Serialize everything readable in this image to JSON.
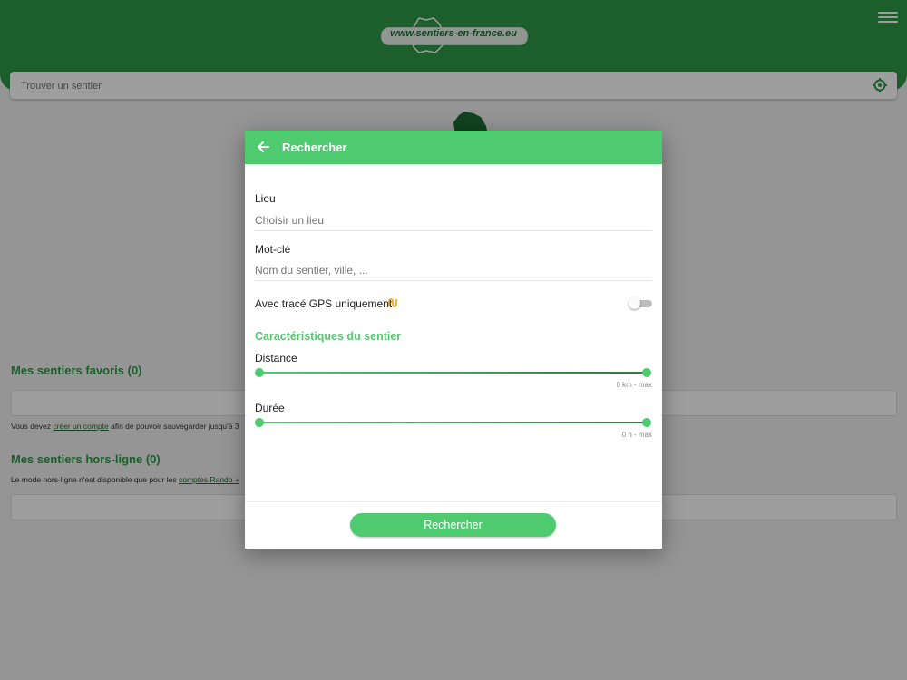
{
  "header": {
    "logo_text": "www.sentiers-en-france.eu"
  },
  "search": {
    "placeholder": "Trouver un sentier"
  },
  "favorites": {
    "title": "Mes sentiers favoris (0)",
    "note_prefix": "Vous devez ",
    "note_link": "créer un compte",
    "note_suffix": " afin de pouvoir sauvegarder jusqu'à 3"
  },
  "offline": {
    "title": "Mes sentiers hors-ligne (0)",
    "note_prefix": "Le mode hors-ligne n'est disponible que pour les ",
    "note_link": "comptes Rando +"
  },
  "modal": {
    "title": "Rechercher",
    "lieu_label": "Lieu",
    "lieu_placeholder": "Choisir un lieu",
    "motcle_label": "Mot-clé",
    "motcle_placeholder": "Nom du sentier, ville, ...",
    "gps_label": "Avec tracé GPS uniquement",
    "gps_enabled": false,
    "section_title": "Caractéristiques du sentier",
    "distance_label": "Distance",
    "distance_range": "0 km - max",
    "duree_label": "Durée",
    "duree_range": "0 h - max",
    "submit_label": "Rechercher"
  },
  "colors": {
    "header_green": "#2e9a48",
    "accent_green": "#4ecb6e",
    "gps_icon": "#f39c12"
  }
}
